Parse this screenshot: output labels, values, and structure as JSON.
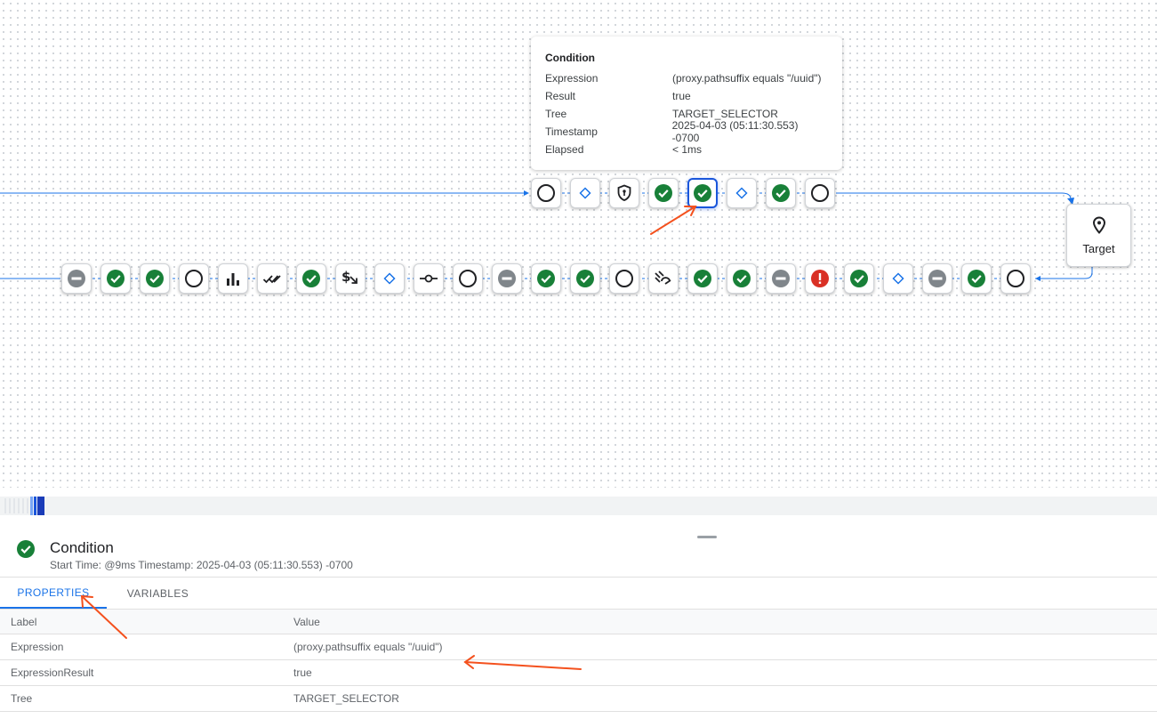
{
  "tooltip": {
    "title": "Condition",
    "rows": [
      {
        "label": "Expression",
        "value": "(proxy.pathsuffix equals \"/uuid\")"
      },
      {
        "label": "Result",
        "value": "true"
      },
      {
        "label": "Tree",
        "value": "TARGET_SELECTOR"
      },
      {
        "label": "Timestamp",
        "value": "2025-04-03 (05:11:30.553) -0700"
      },
      {
        "label": "Elapsed",
        "value": "< 1ms"
      }
    ]
  },
  "request_flow": [
    "circle",
    "diamond",
    "shield",
    "check",
    "check",
    "diamond",
    "check",
    "circle"
  ],
  "response_flow": [
    "minus",
    "check",
    "check",
    "circle",
    "bars",
    "double-check",
    "check",
    "dollar-arrow",
    "diamond",
    "commit",
    "circle",
    "minus",
    "check",
    "check",
    "circle",
    "spike-arrest",
    "check",
    "check",
    "minus",
    "error",
    "check",
    "diamond",
    "minus",
    "check",
    "circle"
  ],
  "target": {
    "label": "Target",
    "icon": "location-pin-icon"
  },
  "detail": {
    "icon": "check-circle-icon",
    "title": "Condition",
    "subtitle": "Start Time: @9ms Timestamp: 2025-04-03 (05:11:30.553) -0700"
  },
  "tabs": [
    {
      "label": "PROPERTIES",
      "active": true
    },
    {
      "label": "VARIABLES",
      "active": false
    }
  ],
  "table": {
    "headers": {
      "label": "Label",
      "value": "Value"
    },
    "rows": [
      {
        "label": "Expression",
        "value": "(proxy.pathsuffix equals \"/uuid\")"
      },
      {
        "label": "ExpressionResult",
        "value": "true"
      },
      {
        "label": "Tree",
        "value": "TARGET_SELECTOR"
      }
    ]
  },
  "colors": {
    "success": "#188038",
    "error": "#d93025",
    "skipped": "#80868b",
    "accent": "#1a73e8",
    "annotation": "#f4511e"
  }
}
